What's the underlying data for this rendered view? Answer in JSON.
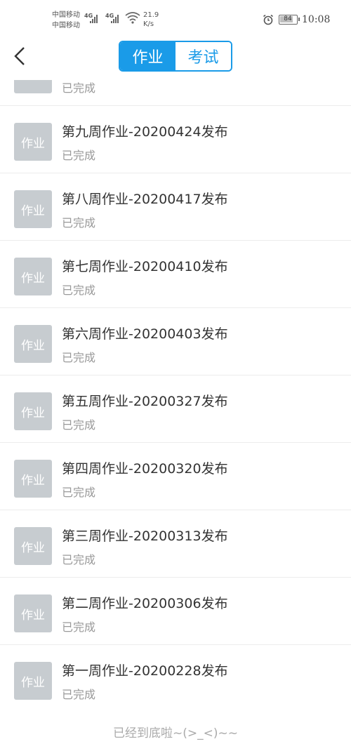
{
  "status_bar": {
    "carrier_1": "中国移动",
    "carrier_2": "中国移动",
    "network_1": "4G",
    "network_2": "4G",
    "speed_value": "21.9",
    "speed_unit": "K/s",
    "battery": "84",
    "battery_level": 0.84,
    "time": "10:08",
    "icons": [
      "signal-icon",
      "wifi-icon",
      "alarm-icon",
      "battery-icon"
    ]
  },
  "header": {
    "back_icon": "chevron-left-icon",
    "tabs": [
      {
        "label": "作业",
        "active": true
      },
      {
        "label": "考试",
        "active": false
      }
    ],
    "accent_color": "#1a9be8"
  },
  "list": {
    "partial_item": {
      "status": "已完成"
    },
    "items": [
      {
        "thumb": "作业",
        "title": "第九周作业-20200424发布",
        "status": "已完成"
      },
      {
        "thumb": "作业",
        "title": "第八周作业-20200417发布",
        "status": "已完成"
      },
      {
        "thumb": "作业",
        "title": "第七周作业-20200410发布",
        "status": "已完成"
      },
      {
        "thumb": "作业",
        "title": "第六周作业-20200403发布",
        "status": "已完成"
      },
      {
        "thumb": "作业",
        "title": "第五周作业-20200327发布",
        "status": "已完成"
      },
      {
        "thumb": "作业",
        "title": "第四周作业-20200320发布",
        "status": "已完成"
      },
      {
        "thumb": "作业",
        "title": "第三周作业-20200313发布",
        "status": "已完成"
      },
      {
        "thumb": "作业",
        "title": "第二周作业-20200306发布",
        "status": "已完成"
      },
      {
        "thumb": "作业",
        "title": "第一周作业-20200228发布",
        "status": "已完成"
      }
    ]
  },
  "footer": {
    "end_text": "已经到底啦~(>_<)~~"
  }
}
